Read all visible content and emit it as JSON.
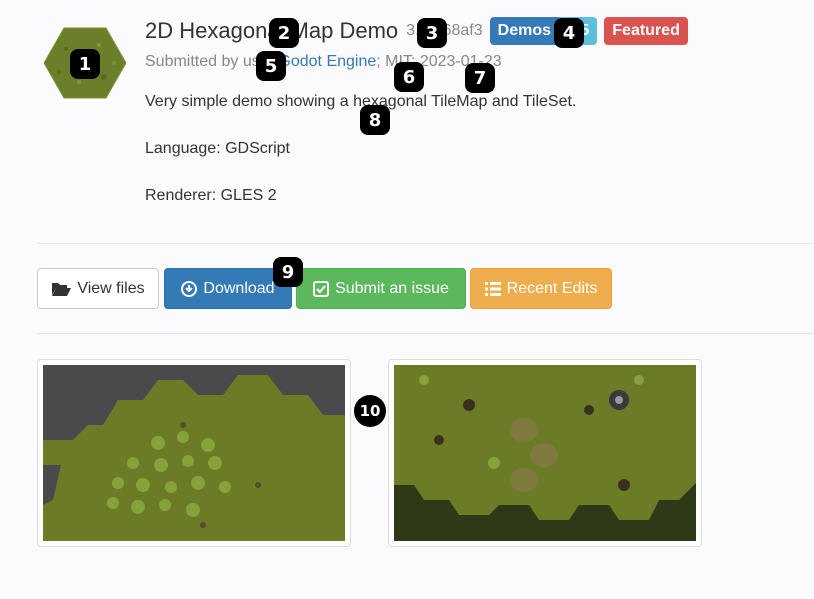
{
  "asset": {
    "title": "2D Hexagonal Map Demo",
    "commit": "3.5-268af3",
    "category_badge": "Demos",
    "version_badge": "3.5",
    "featured_badge": "Featured",
    "submitted_prefix": "Submitted by user",
    "author": "Godot Engine",
    "license": "MIT",
    "date": "2023-01-23",
    "meta_sep1": "; ",
    "meta_sep2": "; ",
    "icon": "hexagon-tile-icon"
  },
  "description": {
    "line1": "Very simple demo showing a hexagonal TileMap and TileSet.",
    "language": "Language: GDScript",
    "renderer": "Renderer: GLES 2"
  },
  "actions": {
    "view_files": "View files",
    "download": "Download",
    "submit_issue": "Submit an issue",
    "recent_edits": "Recent Edits"
  },
  "markers": [
    "1",
    "2",
    "3",
    "4",
    "5",
    "6",
    "7",
    "8",
    "9",
    "10"
  ],
  "colors": {
    "primary": "#337ab7",
    "info": "#5bc0de",
    "danger": "#d9534f",
    "success": "#5cb85c",
    "warning": "#f0ad4e",
    "grass": "#6b7a24"
  }
}
